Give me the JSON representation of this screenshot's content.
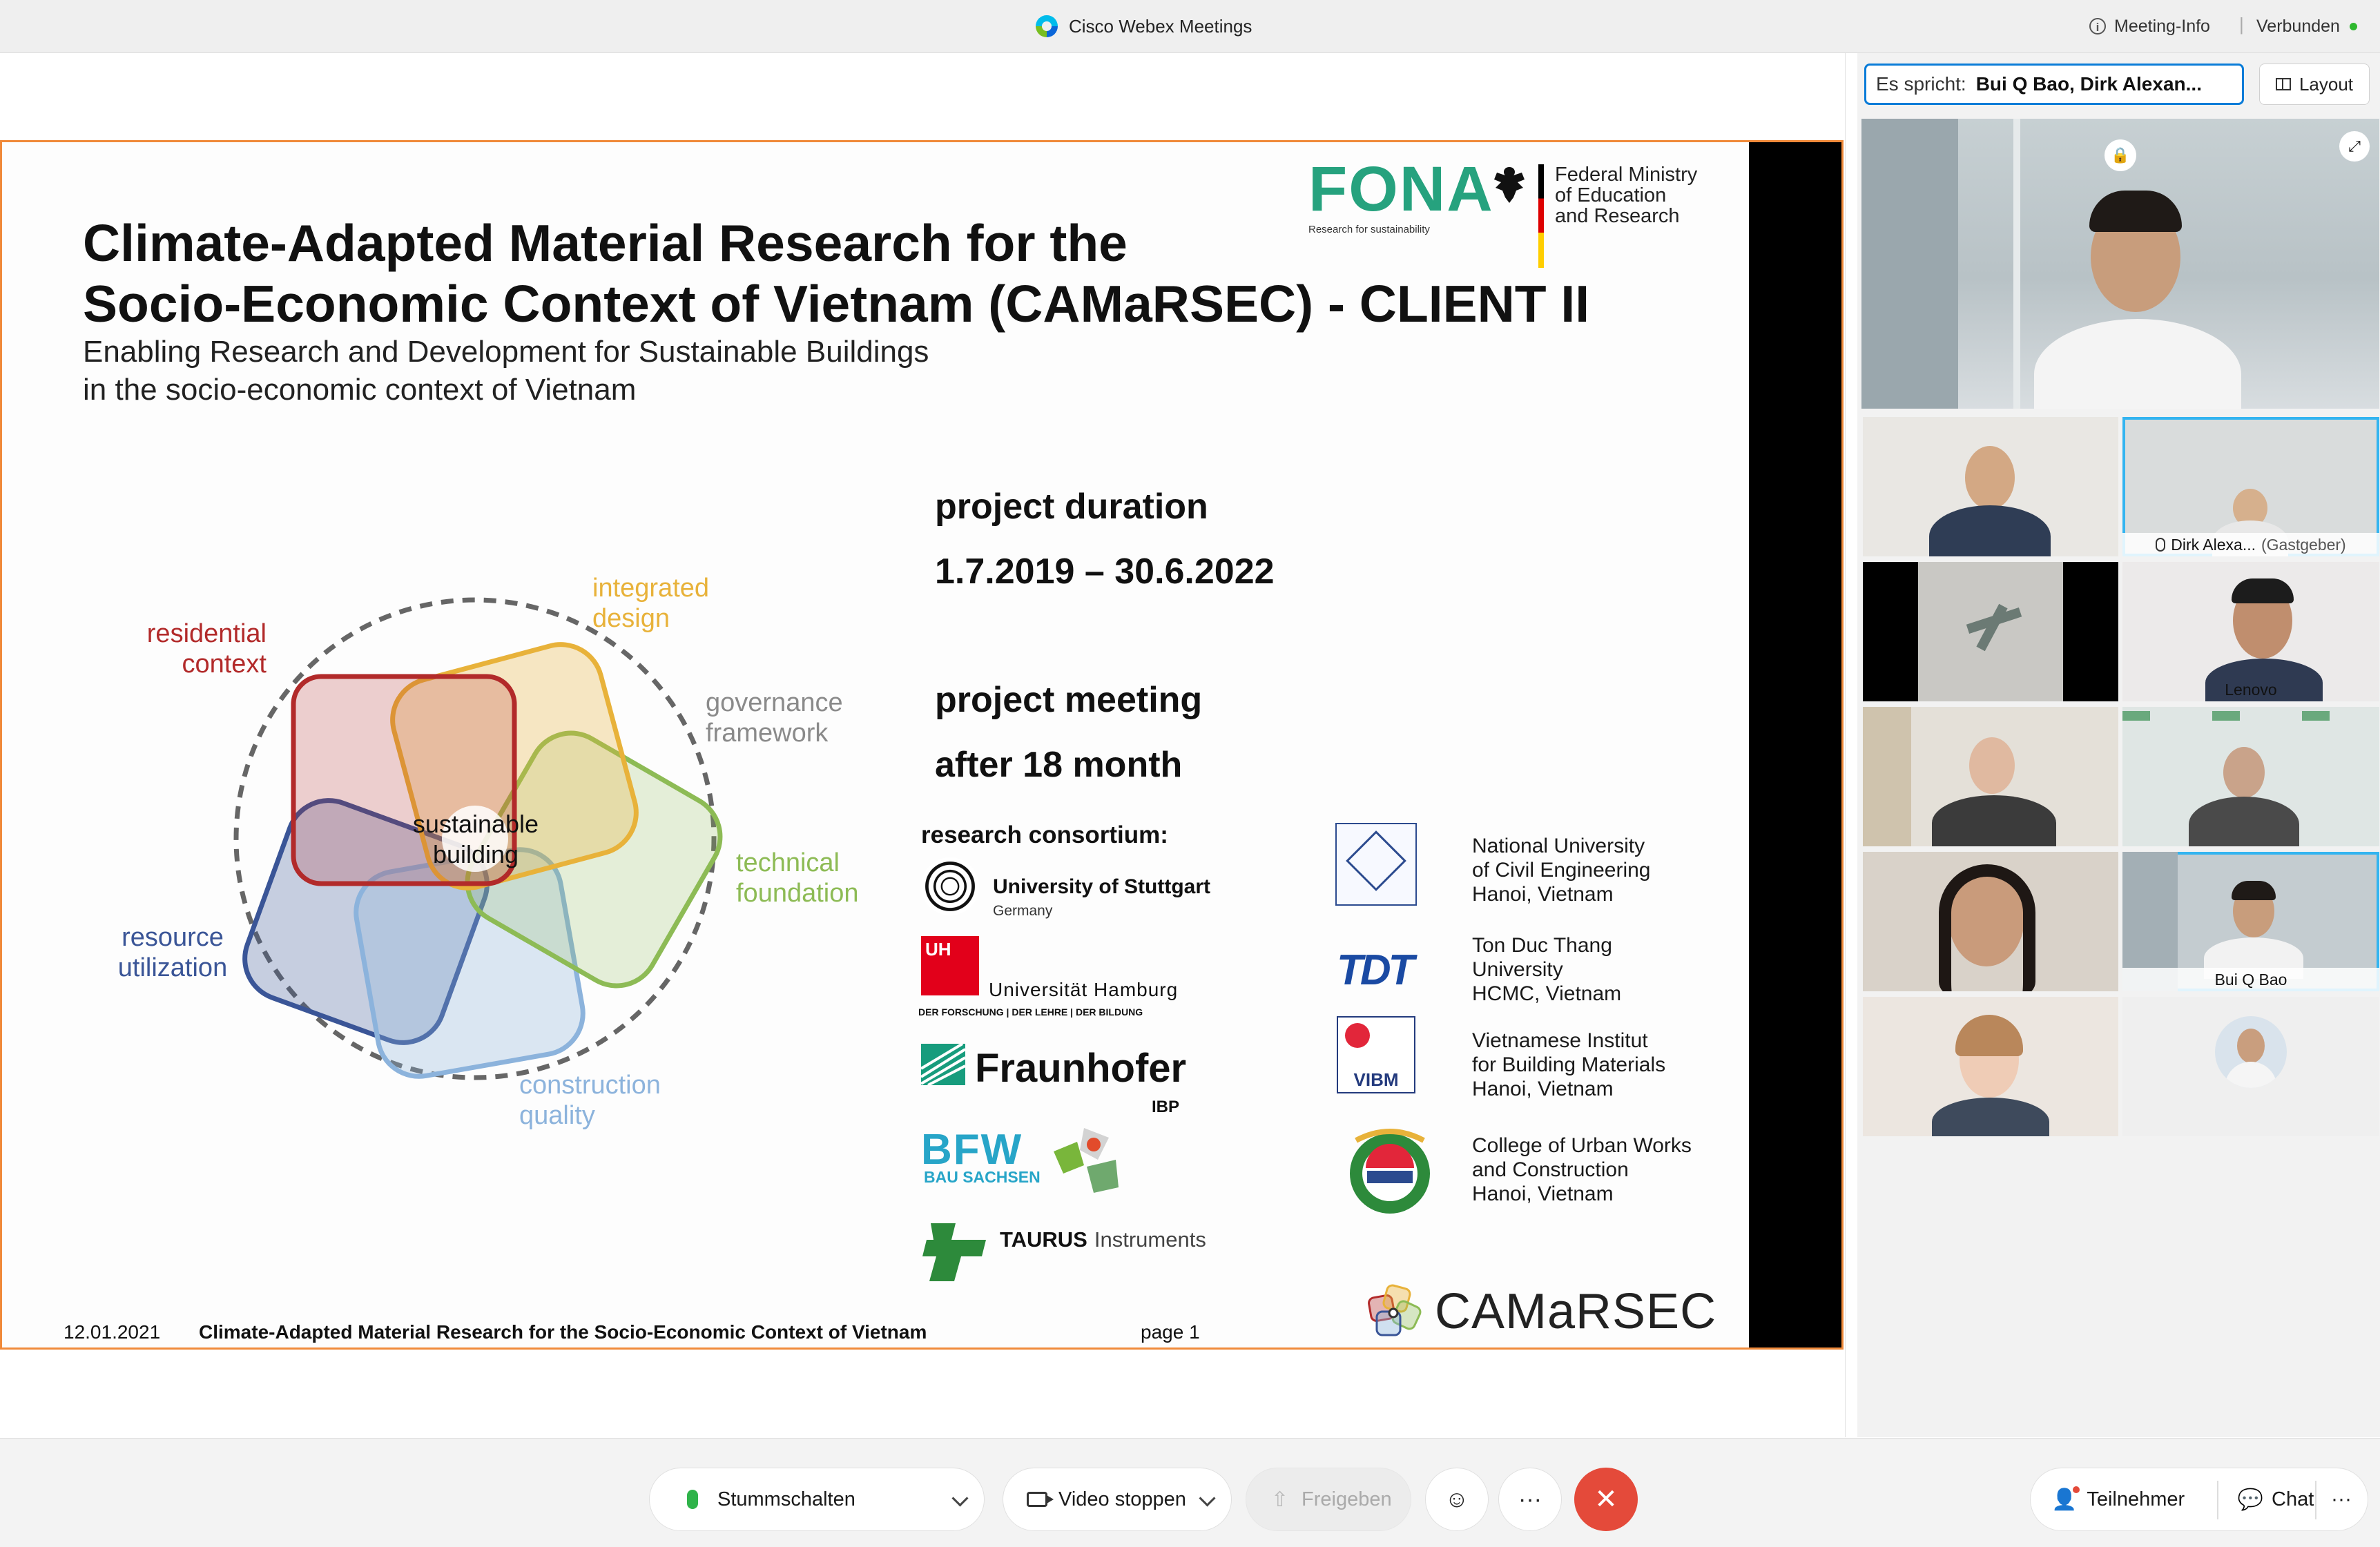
{
  "window": {
    "app_title": "Cisco Webex Meetings",
    "meeting_info": "Meeting-Info",
    "separator": "|",
    "status": "Verbunden"
  },
  "slide": {
    "title_line1": "Climate-Adapted Material Research for the",
    "title_line2": "Socio-Economic Context of Vietnam (CAMaRSEC) - CLIENT II",
    "subtitle_line1": "Enabling Research and Development for Sustainable Buildings",
    "subtitle_line2": "in the socio-economic context of Vietnam",
    "fona": {
      "name": "FONA",
      "tagline": "Research for sustainability"
    },
    "ministry": {
      "line1": "Federal Ministry",
      "line2": "of Education",
      "line3": "and Research"
    },
    "project_duration_label": "project duration",
    "project_duration_value": "1.7.2019 – 30.6.2022",
    "project_meeting_label": "project meeting",
    "project_meeting_value": "after 18 month",
    "diagram": {
      "center_line1": "sustainable",
      "center_line2": "building",
      "residential_1": "residential",
      "residential_2": "context",
      "integrated_1": "integrated",
      "integrated_2": "design",
      "governance_1": "governance",
      "governance_2": "framework",
      "technical_1": "technical",
      "technical_2": "foundation",
      "construction_1": "construction",
      "construction_2": "quality",
      "resource_1": "resource",
      "resource_2": "utilization",
      "colors": {
        "residential": "#b22a2a",
        "integrated": "#e8b23a",
        "technical": "#8dbb55",
        "construction": "#8cb3dc",
        "resource": "#3a5597",
        "governance": "#8a8a8a"
      }
    },
    "consortium_title": "research consortium:",
    "partners_left": {
      "stuttgart_name": "University of Stuttgart",
      "stuttgart_sub": "Germany",
      "hamburg_badge": "UH",
      "hamburg_name": "Universität Hamburg",
      "hamburg_sub": "DER FORSCHUNG | DER LEHRE | DER BILDUNG",
      "fraunhofer_name": "Fraunhofer",
      "fraunhofer_sub": "IBP",
      "bfw_name": "BFW",
      "bfw_sub": "BAU SACHSEN",
      "taurus_name": "TAURUS",
      "taurus_sub": "Instruments"
    },
    "partners_right": {
      "nuce_1": "National University",
      "nuce_2": "of Civil Engineering",
      "nuce_3": "Hanoi, Vietnam",
      "tdt_badge": "TDT",
      "tdt_1": "Ton Duc Thang",
      "tdt_2": "University",
      "tdt_3": "HCMC, Vietnam",
      "vibm_badge": "VIBM",
      "vibm_1": "Vietnamese Institut",
      "vibm_2": "for Building Materials",
      "vibm_3": "Hanoi, Vietnam",
      "cuwc_1": "College of Urban Works",
      "cuwc_2": "and Construction",
      "cuwc_3": "Hanoi, Vietnam"
    },
    "footer": {
      "date": "12.01.2021",
      "title": "Climate-Adapted Material Research for the Socio-Economic Context of Vietnam",
      "page": "page 1",
      "logo_text": "CAMaRSEC"
    }
  },
  "panel": {
    "speaking_label": "Es spricht:",
    "speaking_names": "Bui Q Bao,   Dirk Alexan...",
    "layout_label": "Layout",
    "tiles": [
      {
        "name": ""
      },
      {
        "name": "Dirk Alexa...",
        "role": "(Gastgeber)"
      },
      {
        "name": ""
      },
      {
        "name": "Lenovo"
      },
      {
        "name": ""
      },
      {
        "name": ""
      },
      {
        "name": ""
      },
      {
        "name": "Bui Q Bao"
      },
      {
        "name": ""
      },
      {
        "name": ""
      }
    ]
  },
  "controls": {
    "mute": "Stummschalten",
    "video": "Video stoppen",
    "share": "Freigeben",
    "more": "···",
    "end": "✕",
    "emoji": "☺",
    "participants": "Teilnehmer",
    "chat": "Chat",
    "right_more": "···"
  }
}
